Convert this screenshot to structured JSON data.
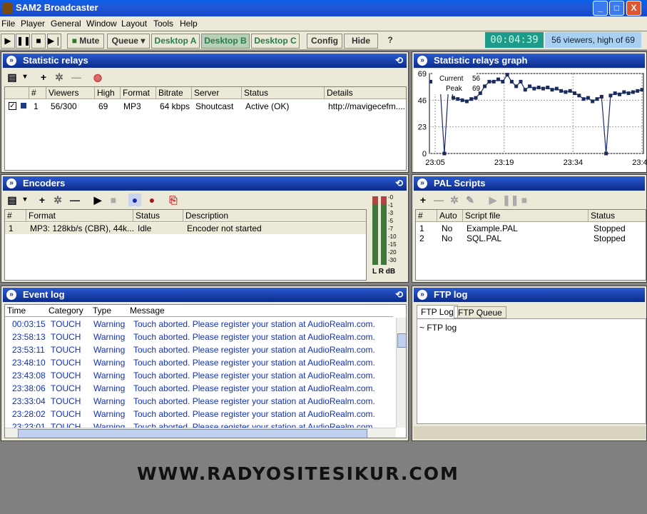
{
  "window": {
    "title": "SAM2 Broadcaster",
    "minimize": "_",
    "maximize": "□",
    "close": "X"
  },
  "menu": [
    "File",
    "Player",
    "General",
    "Window",
    "Layout",
    "Tools",
    "Help"
  ],
  "toolbar": {
    "mute": "Mute",
    "queue": "Queue",
    "desktops": [
      "Desktop A",
      "Desktop B",
      "Desktop C"
    ],
    "config": "Config",
    "hide": "Hide",
    "help": "?",
    "time": "00:04:39",
    "viewers": "56 viewers, high of 69"
  },
  "relays": {
    "title": "Statistic relays",
    "headers": [
      "#",
      "Viewers",
      "High",
      "Format",
      "Bitrate",
      "Server",
      "Status",
      "Details"
    ],
    "rows": [
      [
        "1",
        "56/300",
        "69",
        "MP3",
        "64 kbps",
        "Shoutcast",
        "Active (OK)",
        "http://mavigecefm...."
      ]
    ]
  },
  "graph": {
    "title": "Statistic relays graph",
    "current_label": "Current",
    "current": "56",
    "peak_label": "Peak",
    "peak": "69"
  },
  "chart_data": {
    "type": "line",
    "yticks": [
      "69",
      "46",
      "23",
      "0"
    ],
    "xticks": [
      "23:05",
      "23:19",
      "23:34",
      "23:48"
    ],
    "ylim": [
      0,
      69
    ],
    "values": [
      62,
      58,
      62,
      0,
      62,
      48,
      47,
      46,
      45,
      47,
      48,
      52,
      58,
      62,
      62,
      64,
      62,
      68,
      62,
      58,
      62,
      55,
      58,
      56,
      57,
      56,
      57,
      55,
      56,
      54,
      53,
      54,
      52,
      50,
      47,
      48,
      45,
      47,
      49,
      0,
      50,
      52,
      51,
      53,
      52,
      53,
      54,
      55
    ]
  },
  "encoders": {
    "title": "Encoders",
    "headers": [
      "#",
      "Format",
      "Status",
      "Description"
    ],
    "rows": [
      [
        "1",
        "MP3: 128kb/s (CBR), 44k...",
        "Idle",
        "Encoder not started"
      ]
    ],
    "vu_labels": [
      "-0",
      "-1",
      "-3",
      "-5",
      "-7",
      "-10",
      "-15",
      "-20",
      "-30"
    ],
    "lr": "L R dB"
  },
  "pal": {
    "title": "PAL Scripts",
    "headers": [
      "#",
      "Auto",
      "Script file",
      "Status"
    ],
    "rows": [
      [
        "1",
        "No",
        "Example.PAL",
        "Stopped"
      ],
      [
        "2",
        "No",
        "SQL.PAL",
        "Stopped"
      ]
    ]
  },
  "eventlog": {
    "title": "Event log",
    "headers": [
      "Time",
      "Category",
      "Type",
      "Message"
    ],
    "rows": [
      [
        "00:03:15",
        "TOUCH",
        "Warning",
        "Touch aborted. Please register your station at AudioRealm.com."
      ],
      [
        "23:58:13",
        "TOUCH",
        "Warning",
        "Touch aborted. Please register your station at AudioRealm.com."
      ],
      [
        "23:53:11",
        "TOUCH",
        "Warning",
        "Touch aborted. Please register your station at AudioRealm.com."
      ],
      [
        "23:48:10",
        "TOUCH",
        "Warning",
        "Touch aborted. Please register your station at AudioRealm.com."
      ],
      [
        "23:43:08",
        "TOUCH",
        "Warning",
        "Touch aborted. Please register your station at AudioRealm.com."
      ],
      [
        "23:38:06",
        "TOUCH",
        "Warning",
        "Touch aborted. Please register your station at AudioRealm.com."
      ],
      [
        "23:33:04",
        "TOUCH",
        "Warning",
        "Touch aborted. Please register your station at AudioRealm.com."
      ],
      [
        "23:28:02",
        "TOUCH",
        "Warning",
        "Touch aborted. Please register your station at AudioRealm.com."
      ],
      [
        "23:23:01",
        "TOUCH",
        "Warning",
        "Touch aborted. Please register your station at AudioRealm.com."
      ]
    ]
  },
  "ftp": {
    "title": "FTP log",
    "tabs": [
      "FTP Log",
      "FTP Queue"
    ],
    "content": "~ FTP log"
  },
  "banner": "WWW.RADYOSITESIKUR.COM"
}
